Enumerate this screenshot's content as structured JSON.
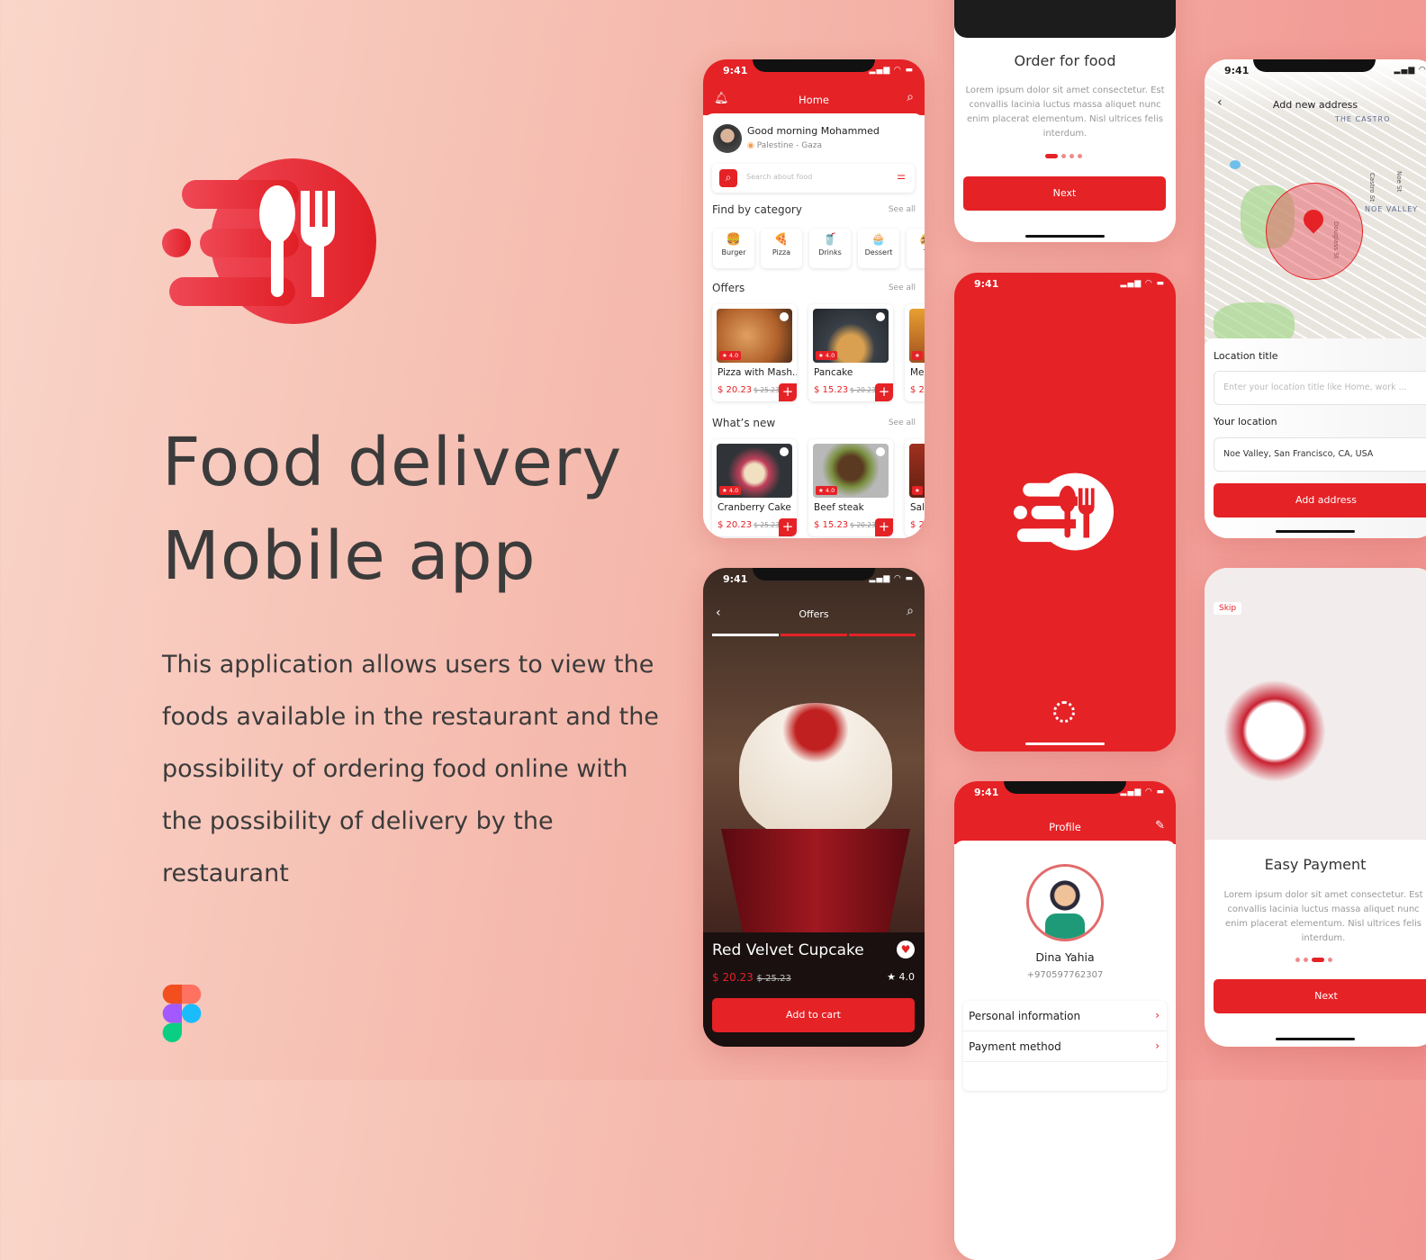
{
  "promo": {
    "title_line1": "Food delivery",
    "title_line2": "Mobile app",
    "description": "This application allows users to view the foods available in the restaurant and the possibility of ordering food online with the possibility of delivery by the restaurant",
    "figma_icon": "figma-logo",
    "brand_color": "#e52226"
  },
  "status": {
    "time": "9:41",
    "icons": "▂▄▆ ◠ ▬"
  },
  "home": {
    "title": "Home",
    "greeting": "Good morning Mohammed",
    "location": "Palestine - Gaza",
    "search_placeholder": "Search about food",
    "category_title": "Find by category",
    "see_all": "See all",
    "categories": [
      {
        "label": "Burger",
        "icon": "🍔"
      },
      {
        "label": "Pizza",
        "icon": "🍕"
      },
      {
        "label": "Drinks",
        "icon": "🥤"
      },
      {
        "label": "Dessert",
        "icon": "🧁"
      },
      {
        "label": "To",
        "icon": "🌮"
      }
    ],
    "offers_title": "Offers",
    "offers": [
      {
        "name": "Pizza with Mash..",
        "price": "$ 20.23",
        "old": "$ 25.23",
        "rating": "★ 4.0"
      },
      {
        "name": "Pancake",
        "price": "$ 15.23",
        "old": "$ 20.23",
        "rating": "★ 4.0"
      },
      {
        "name": "Me",
        "price": "$ 2",
        "rating": "★"
      }
    ],
    "new_title": "What’s new",
    "new": [
      {
        "name": "Cranberry Cake",
        "price": "$ 20.23",
        "old": "$ 25.23",
        "rating": "★ 4.0"
      },
      {
        "name": "Beef steak",
        "price": "$ 15.23",
        "old": "$ 20.23",
        "rating": "★ 4.0"
      },
      {
        "name": "Sal",
        "price": "$ 2",
        "rating": "★"
      }
    ]
  },
  "onboard1": {
    "title": "Order for food",
    "body": "Lorem ipsum dolor sit amet consectetur. Est convallis lacinia luctus massa aliquet nunc enim placerat elementum. Nisl ultrices felis interdum.",
    "button": "Next"
  },
  "address": {
    "title": "Add new address",
    "map_labels": {
      "castro": "THE CASTRO",
      "noe": "NOE VALLEY",
      "douglass": "Douglass St",
      "castro_st": "Castro St",
      "noe_st": "Noe St"
    },
    "location_title_label": "Location title",
    "location_title_placeholder": "Enter your location title like Home, work ...",
    "your_location_label": "Your location",
    "your_location_value": "Noe Valley, San Francisco, CA, USA",
    "button": "Add address"
  },
  "offers_detail": {
    "title": "Offers",
    "item_name": "Red Velvet Cupcake",
    "price": "$ 20.23",
    "old_price": "$ 25.23",
    "rating": "★ 4.0",
    "button": "Add to cart"
  },
  "profile": {
    "title": "Profile",
    "name": "Dina Yahia",
    "phone": "+970597762307",
    "items": [
      {
        "label": "Personal information"
      },
      {
        "label": "Payment method"
      }
    ]
  },
  "onboard2": {
    "skip": "Skip",
    "title": "Easy Payment",
    "body": "Lorem ipsum dolor sit amet consectetur. Est convallis lacinia luctus massa aliquet nunc enim placerat elementum. Nisl ultrices felis interdum.",
    "button": "Next"
  }
}
